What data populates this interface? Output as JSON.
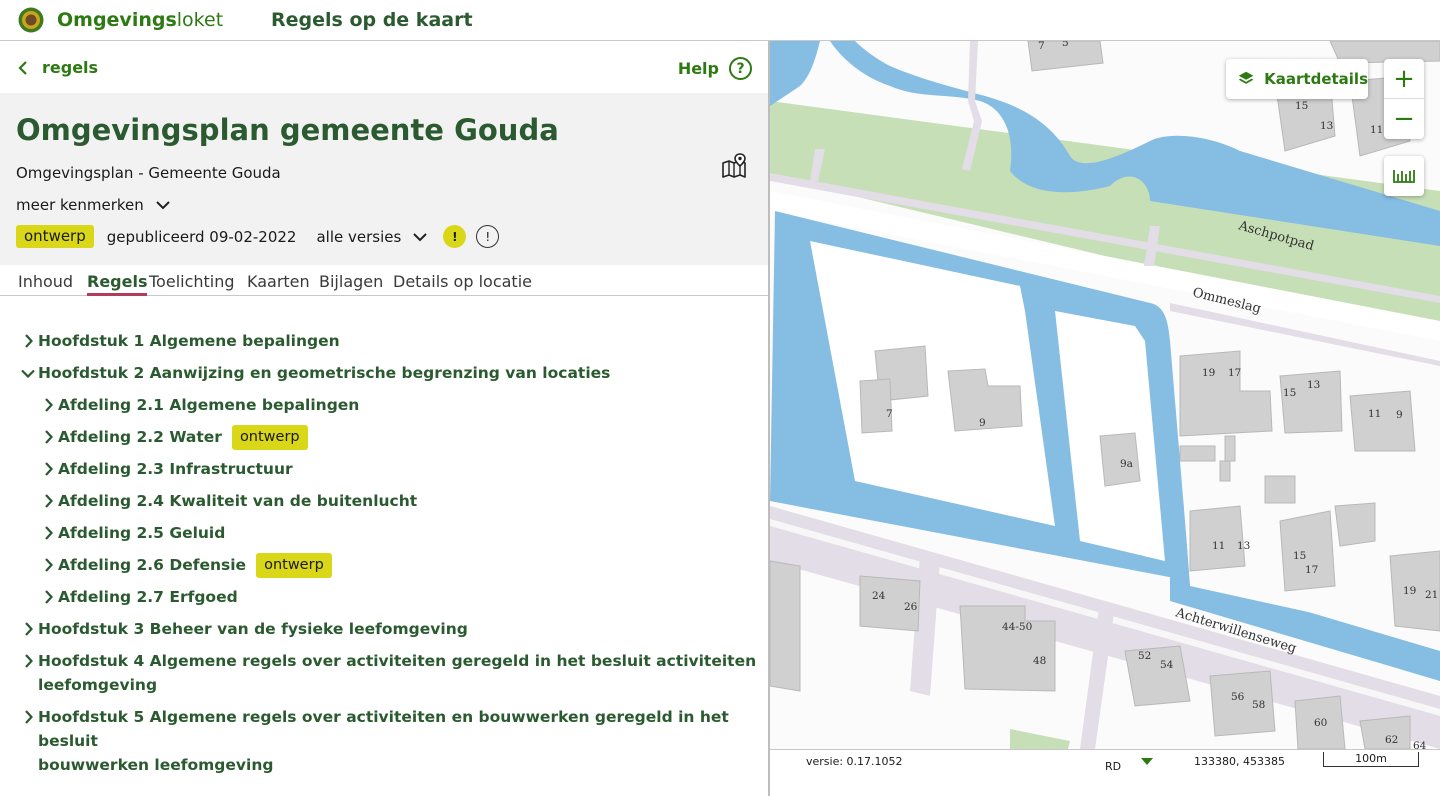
{
  "header": {
    "brand_bold": "Omgevings",
    "brand_rest": "loket",
    "app_title": "Regels op de kaart"
  },
  "nav": {
    "back_label": "regels",
    "help_label": "Help"
  },
  "plan": {
    "title": "Omgevingsplan gemeente Gouda",
    "subtitle": "Omgevingsplan - Gemeente Gouda",
    "more_label": "meer kenmerken",
    "status_badge": "ontwerp",
    "published": "gepubliceerd 09-02-2022",
    "versions_label": "alle versies",
    "warn_symbol": "!",
    "info_symbol": "!"
  },
  "tabs": [
    "Inhoud",
    "Regels",
    "Toelichting",
    "Kaarten",
    "Bijlagen",
    "Details op locatie"
  ],
  "active_tab": "Regels",
  "tree": [
    {
      "label": "Hoofdstuk 1 Algemene bepalingen",
      "expanded": false,
      "level": 0
    },
    {
      "label": "Hoofdstuk 2 Aanwijzing en geometrische begrenzing van locaties",
      "expanded": true,
      "level": 0
    },
    {
      "label": "Afdeling 2.1 Algemene bepalingen",
      "expanded": false,
      "level": 1
    },
    {
      "label": "Afdeling 2.2 Water",
      "expanded": false,
      "level": 1,
      "badge": "ontwerp"
    },
    {
      "label": "Afdeling 2.3 Infrastructuur",
      "expanded": false,
      "level": 1
    },
    {
      "label": "Afdeling 2.4 Kwaliteit van de buitenlucht",
      "expanded": false,
      "level": 1
    },
    {
      "label": "Afdeling 2.5 Geluid",
      "expanded": false,
      "level": 1
    },
    {
      "label": "Afdeling 2.6 Defensie",
      "expanded": false,
      "level": 1,
      "badge": "ontwerp"
    },
    {
      "label": "Afdeling 2.7 Erfgoed",
      "expanded": false,
      "level": 1
    },
    {
      "label": "Hoofdstuk 3 Beheer van de fysieke leefomgeving",
      "expanded": false,
      "level": 0
    },
    {
      "label_line1": "Hoofdstuk 4 Algemene regels over activiteiten geregeld in het besluit activiteiten",
      "label_line2": "leefomgeving",
      "expanded": false,
      "level": 0
    },
    {
      "label_line1": "Hoofdstuk 5 Algemene regels over activiteiten en bouwwerken geregeld in het besluit",
      "label_line2": "bouwwerken leefomgeving",
      "expanded": false,
      "level": 0
    }
  ],
  "map": {
    "details_label": "Kaartdetails",
    "zoom_in": "+",
    "zoom_out": "−",
    "streets": [
      "Aschpotpad",
      "Ommeslag",
      "Achterwillenseweg"
    ],
    "house_numbers": [
      "7",
      "5",
      "15",
      "13",
      "11",
      "7",
      "9",
      "9a",
      "19",
      "17",
      "15",
      "13",
      "11",
      "9",
      "11",
      "13",
      "15",
      "17",
      "19",
      "21",
      "24",
      "26",
      "44-50",
      "48",
      "52",
      "54",
      "56",
      "58",
      "60",
      "62",
      "64"
    ],
    "colors": {
      "water": "#85bde3",
      "grass": "#c7dfb7",
      "building": "#d0d0d0",
      "road": "#e2dde6"
    }
  },
  "status": {
    "version": "versie: 0.17.1052",
    "crs": "RD",
    "coords": "133380, 453385",
    "scale": "100m"
  }
}
